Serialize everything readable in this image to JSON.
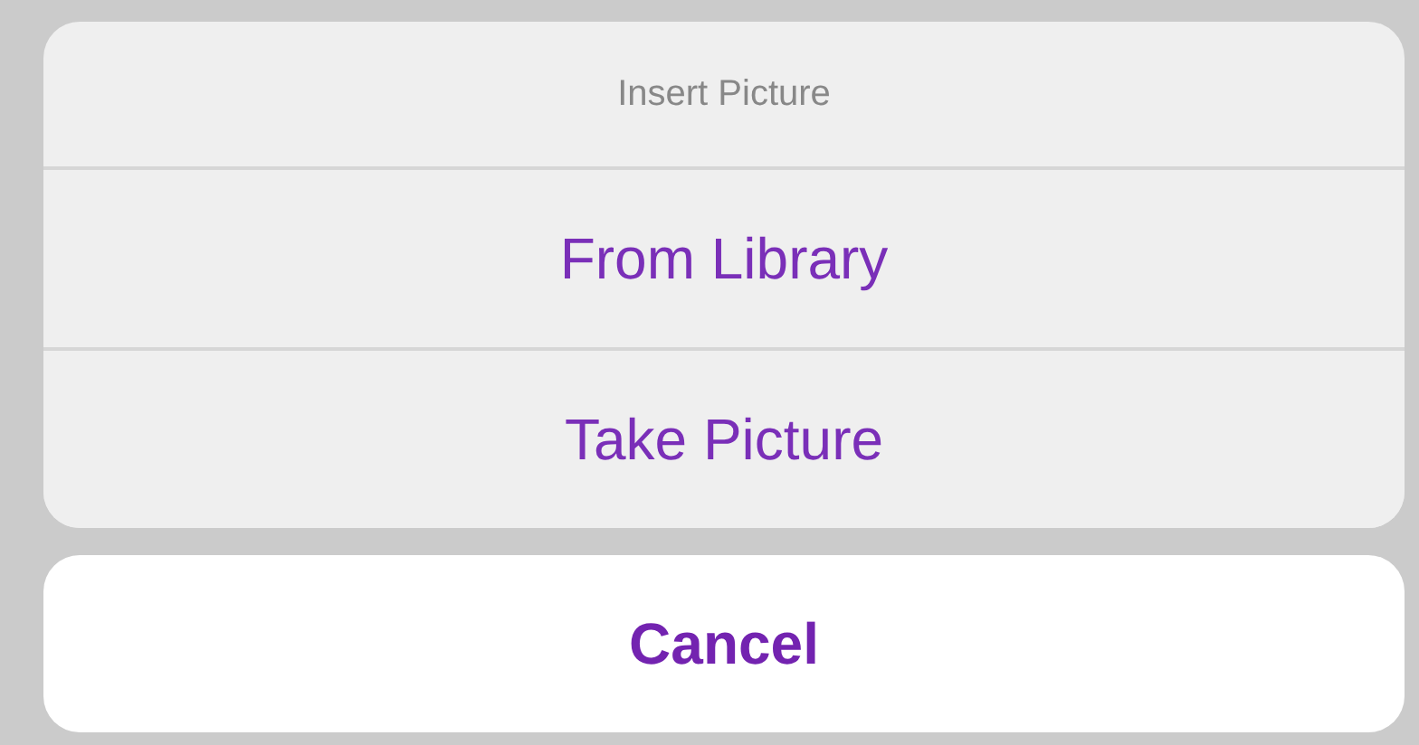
{
  "action_sheet": {
    "title": "Insert Picture",
    "actions": [
      {
        "label": "From Library"
      },
      {
        "label": "Take Picture"
      }
    ],
    "cancel": {
      "label": "Cancel"
    }
  }
}
